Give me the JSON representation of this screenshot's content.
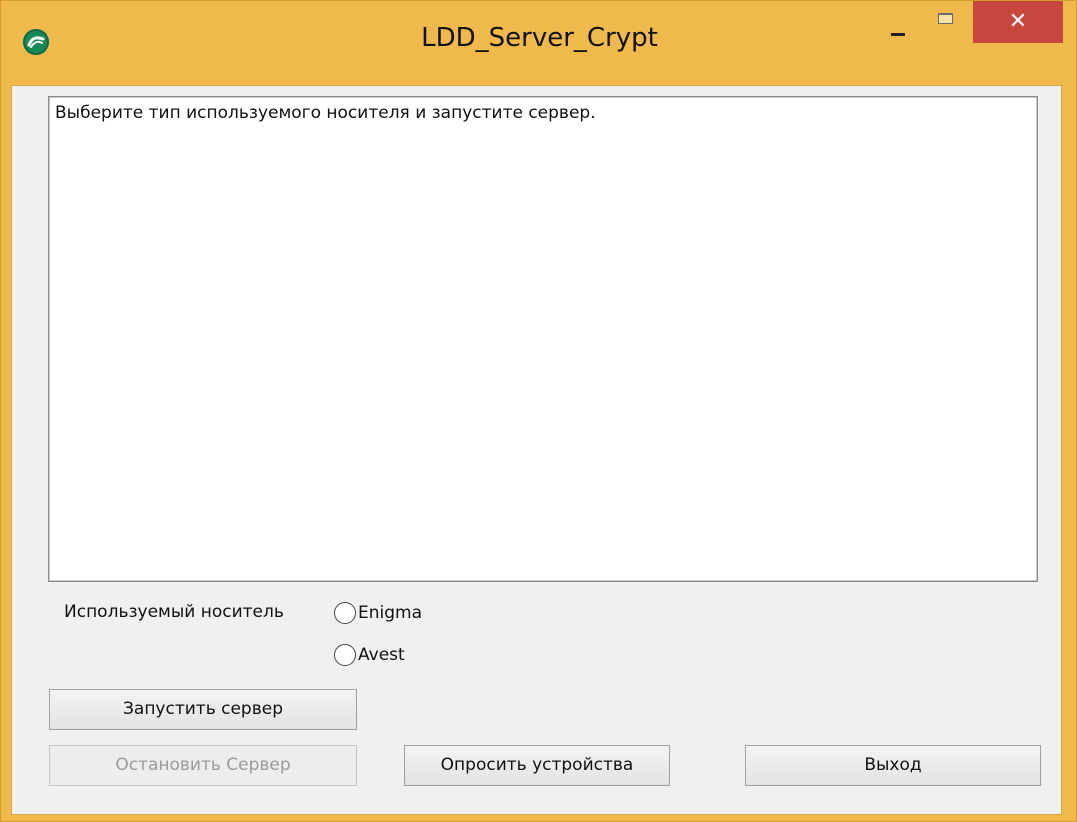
{
  "window": {
    "title": "LDD_Server_Crypt",
    "icon": "app-logo-icon",
    "controls": {
      "minimize": "minimize-icon",
      "maximize": "maximize-icon",
      "close": "close-icon",
      "close_glyph": "✕"
    },
    "colors": {
      "titlebar": "#f0b94c",
      "close_button": "#c7463d",
      "client": "#f0f0f0"
    }
  },
  "log": {
    "text": "Выберите тип используемого носителя и запустите сервер."
  },
  "media": {
    "label": "Используемый носитель",
    "options": [
      {
        "label": "Enigma",
        "selected": false
      },
      {
        "label": "Avest",
        "selected": false
      }
    ]
  },
  "buttons": {
    "start": "Запустить сервер",
    "stop": "Остановить Сервер",
    "poll": "Опросить устройства",
    "exit": "Выход"
  }
}
